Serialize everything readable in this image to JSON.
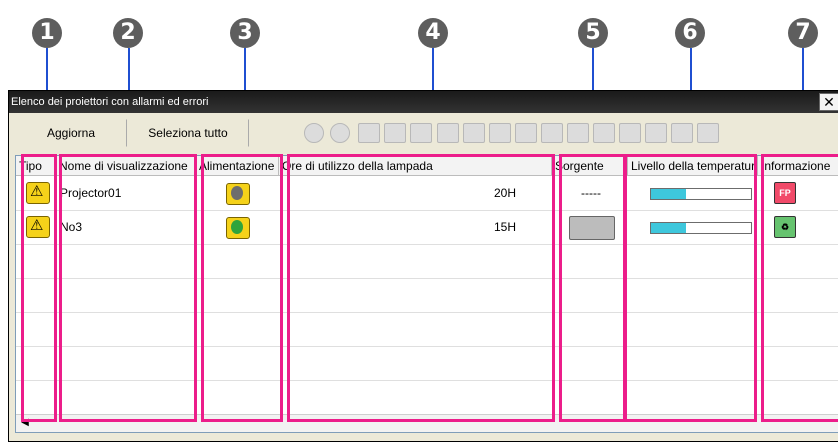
{
  "callouts": [
    "1",
    "2",
    "3",
    "4",
    "5",
    "6",
    "7"
  ],
  "window": {
    "title": "Elenco dei proiettori con allarmi ed errori",
    "close_glyph": "✕"
  },
  "toolbar": {
    "update_label": "Aggiorna",
    "select_all_label": "Seleziona tutto",
    "icons": [
      "power-off-icon",
      "power-on-icon",
      "source-computer1-icon",
      "source-computer2-icon",
      "source-video-icon",
      "source-svideo-icon",
      "source-hdmi-icon",
      "source-network-icon",
      "source-rgb-icon",
      "source-component-icon",
      "source-dvi-icon",
      "source-usb-icon",
      "source-lan-icon",
      "av-mute-icon",
      "av-mute-off-icon",
      "wireless-icon"
    ]
  },
  "columns": [
    "Tipo",
    "Nome di visualizzazione",
    "Alimentazione",
    "Ore di utilizzo della lampada",
    "Sorgente",
    "Livello della temperatura",
    "Informazione"
  ],
  "rows": [
    {
      "type_icon": "warning-icon",
      "name": "Projector01",
      "power_icon": "power-standby-icon",
      "lamp_hours": "20H",
      "source": "-----",
      "temperature_level": 0.35,
      "info_icon": "fp-info-icon"
    },
    {
      "type_icon": "warning-icon",
      "name": "No3",
      "power_icon": "power-on-icon",
      "lamp_hours": "15H",
      "source": "source-computer1-icon",
      "temperature_level": 0.35,
      "info_icon": "lamp-info-icon"
    }
  ],
  "colors": {
    "highlight": "#ec1d8a",
    "callout_line": "#1f4fd1",
    "temperature_fill": "#3ec7dc",
    "warning_bg": "#f5d21a"
  }
}
